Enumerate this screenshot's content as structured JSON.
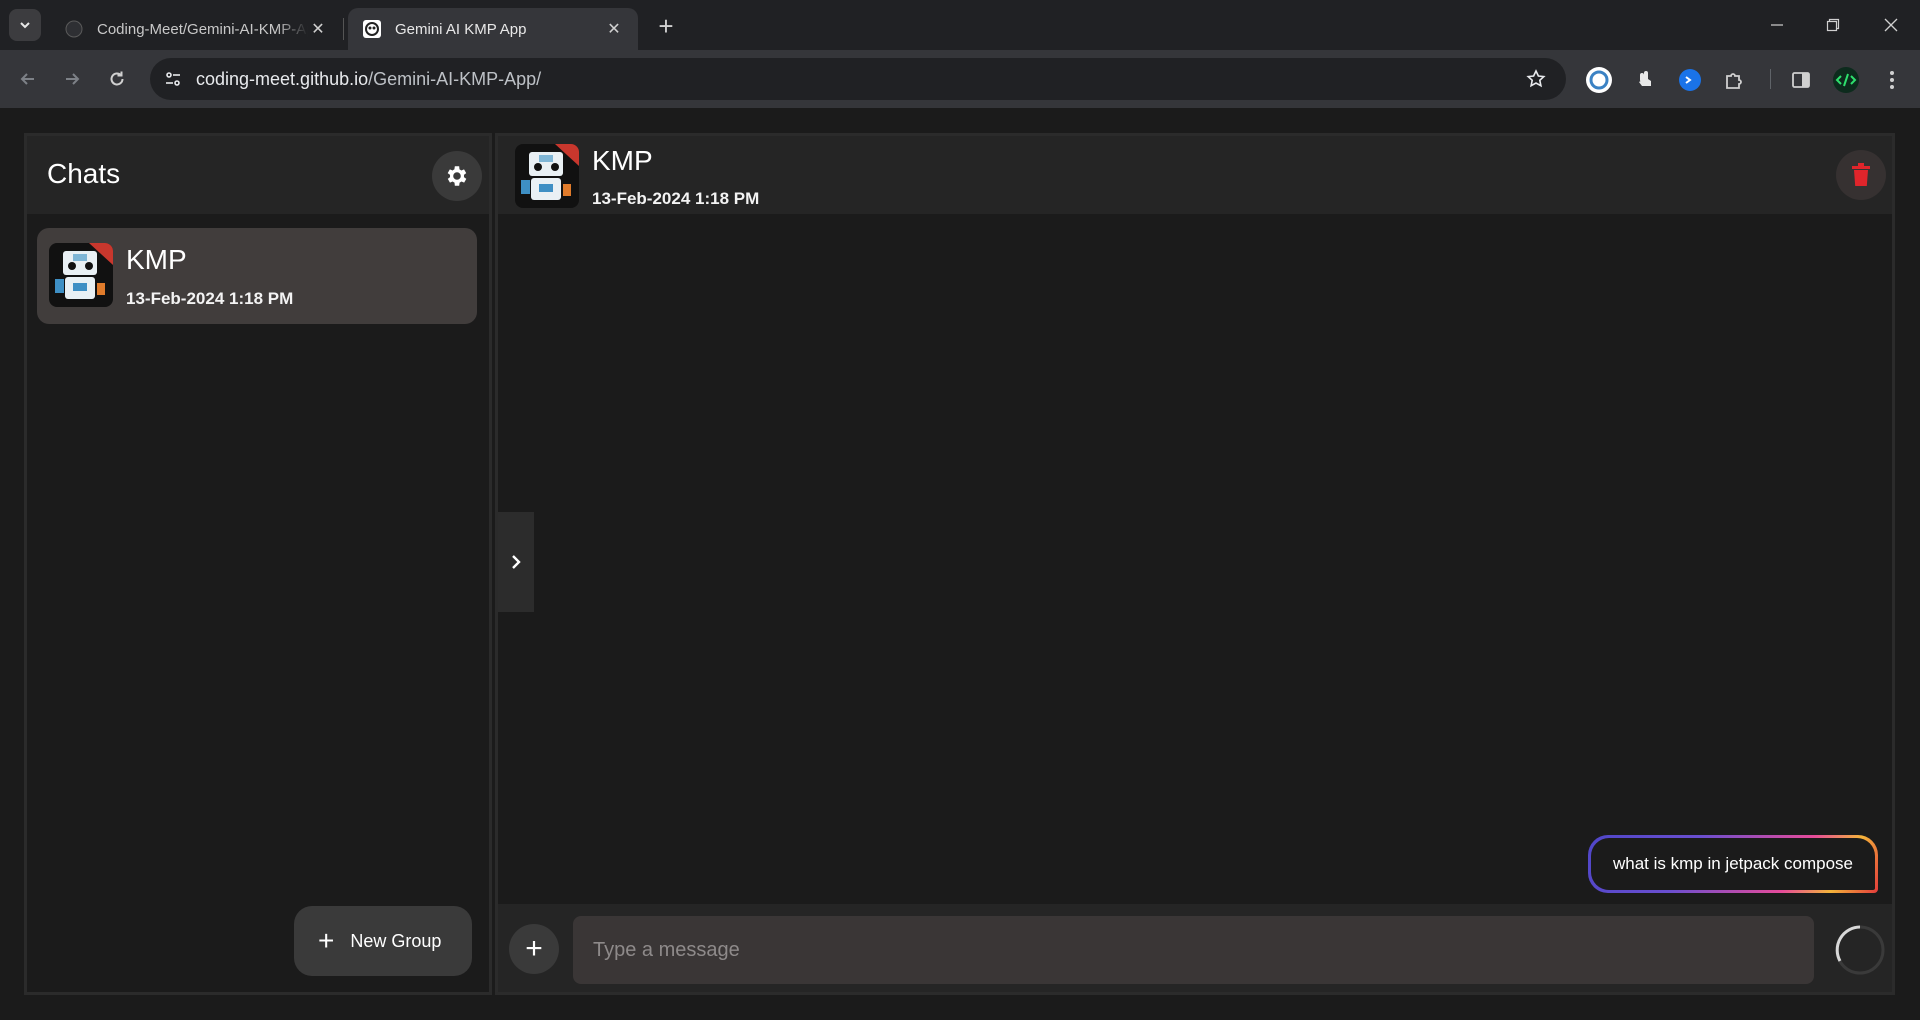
{
  "browser": {
    "tabs": [
      {
        "title": "Coding-Meet/Gemini-AI-KMP-App",
        "active": false
      },
      {
        "title": "Gemini AI KMP App",
        "active": true
      }
    ],
    "url_host": "coding-meet.github.io",
    "url_path": "/Gemini-AI-KMP-App/"
  },
  "sidebar": {
    "title": "Chats",
    "chats": [
      {
        "name": "KMP",
        "time": "13-Feb-2024 1:18 PM"
      }
    ],
    "new_group_label": "New Group"
  },
  "chat": {
    "name": "KMP",
    "time": "13-Feb-2024 1:18 PM",
    "messages": [
      {
        "from": "user",
        "text": "what is kmp in jetpack compose"
      }
    ],
    "input_placeholder": "Type a message"
  },
  "colors": {
    "background": "#1b1b1b",
    "panel_header": "#252525",
    "selected_chat": "#413d3c",
    "delete_red": "#e0252b"
  }
}
